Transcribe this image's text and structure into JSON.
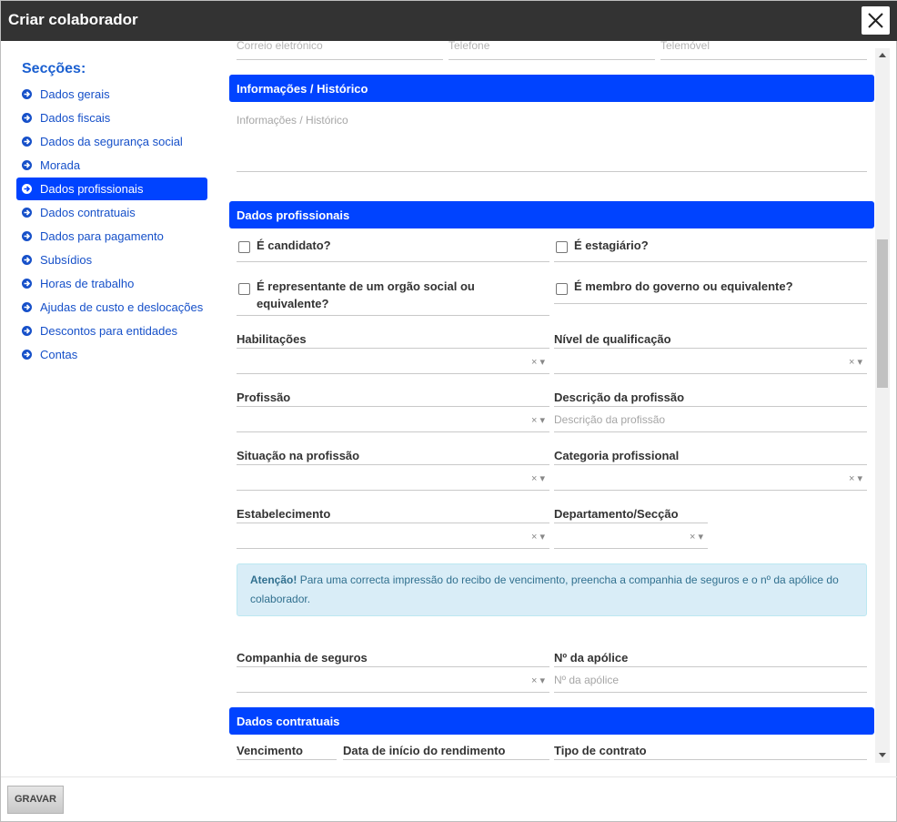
{
  "window": {
    "title": "Criar colaborador"
  },
  "sidebar": {
    "title": "Secções:",
    "items": [
      {
        "label": "Dados gerais"
      },
      {
        "label": "Dados fiscais"
      },
      {
        "label": "Dados da segurança social"
      },
      {
        "label": "Morada"
      },
      {
        "label": "Dados profissionais",
        "active": true
      },
      {
        "label": "Dados contratuais"
      },
      {
        "label": "Dados para pagamento"
      },
      {
        "label": "Subsídios"
      },
      {
        "label": "Horas de trabalho"
      },
      {
        "label": "Ajudas de custo e deslocações"
      },
      {
        "label": "Descontos para entidades"
      },
      {
        "label": "Contas"
      }
    ]
  },
  "top_fields": {
    "email": "Correio eletrónico",
    "phone": "Telefone",
    "mobile": "Telemóvel"
  },
  "info_section": {
    "title": "Informações / Histórico",
    "placeholder": "Informações / Histórico"
  },
  "professional": {
    "title": "Dados profissionais",
    "is_candidate": "É candidato?",
    "is_intern": "É estagiário?",
    "is_representative": "É representante de um orgão social ou equivalente?",
    "is_government": "É membro do governo ou equivalente?",
    "qualifications": "Habilitações",
    "qualification_level": "Nível de qualificação",
    "profession": "Profissão",
    "profession_description": "Descrição da profissão",
    "profession_description_placeholder": "Descrição da profissão",
    "profession_status": "Situação na profissão",
    "professional_category": "Categoria profissional",
    "establishment": "Estabelecimento",
    "department": "Departamento/Secção",
    "alert_strong": "Atenção!",
    "alert_text": "Para uma correcta impressão do recibo de vencimento, preencha a companhia de seguros e o nº da apólice do colaborador.",
    "insurance_company": "Companhia de seguros",
    "policy_number": "Nº da apólice",
    "policy_number_placeholder": "Nº da apólice"
  },
  "contractual": {
    "title": "Dados contratuais",
    "salary": "Vencimento",
    "income_start_date": "Data de início do rendimento",
    "contract_type": "Tipo de contrato"
  },
  "select_control": "× ▾",
  "footer": {
    "save_label": "GRAVAR"
  },
  "colors": {
    "accent": "#0043ff",
    "titlebar": "#333333",
    "link": "#1650c9"
  },
  "icons": {
    "close": "close-icon",
    "section_arrow": "arrow-circle-right-icon"
  }
}
